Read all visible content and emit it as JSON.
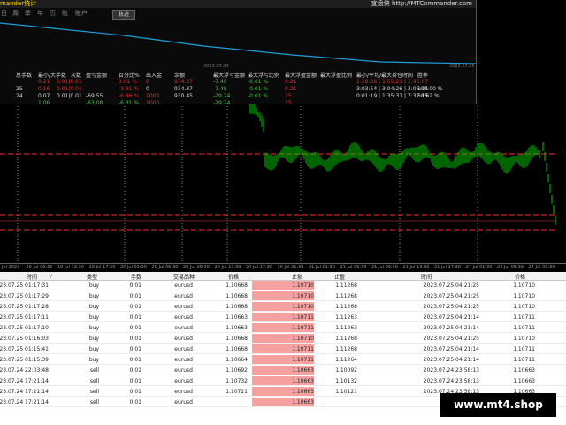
{
  "window": {
    "title": "mander统计",
    "brand": "宜盘侠 http://MTCommander.com"
  },
  "menu": [
    "日",
    "周",
    "季",
    "年",
    "历",
    "账",
    "账户"
  ],
  "track_button": "轨迹",
  "graph_dates": {
    "left": "2023.07.24",
    "right": "2023.07.25"
  },
  "stats": {
    "headers": [
      "总手数",
      "最小/大手数",
      "次数",
      "盈亏金额",
      "百分比%",
      "出入金",
      "余额",
      "最大浮亏金额",
      "最大浮亏比例",
      "最大浮盈金额",
      "最大浮盈比例",
      "最小/平均/最大持仓时间",
      "胜率"
    ],
    "rows": [
      {
        "cells": [
          "",
          "0.21",
          "0.01|0.01",
          "",
          "3.01 %",
          "0",
          "934.37",
          "-7.49",
          "-0.01 %",
          "0.21",
          "",
          "1:28:38 | 1:55:21 | 5:46:07",
          ""
        ],
        "label": ""
      },
      {
        "cells": [
          "25",
          "0.16",
          "0.01|0.01",
          "87",
          "-3.91 %",
          "0",
          "934.37",
          "-7.48",
          "-0.01 %",
          "0.21",
          "",
          "3:03:54 | 3:04:26 | 3:05:35",
          "100.00 %"
        ],
        "label": ""
      },
      {
        "cells": [
          "24",
          "0.07",
          "0.01|0.01",
          "07",
          "-6.96 %",
          "1000",
          "930.45",
          "-29.24",
          "-0.01 %",
          "15",
          "",
          "0:01:19 | 1:35:37 | 7:37:15",
          "58.62 %"
        ],
        "label": ""
      },
      {
        "cells": [
          "",
          "1.06",
          "",
          "",
          "-6.31 %",
          "1000",
          "",
          "-29.24",
          "",
          "15",
          "",
          "",
          ""
        ],
        "label": ""
      }
    ],
    "row_money": [
      "",
      "",
      "-69.55",
      "-63.08"
    ]
  },
  "time_axis": [
    "20 Jul 2023",
    "20 Jul 09:30",
    "19 Jul 13:30",
    "19 Jul 17:30",
    "20 Jul 01:30",
    "20 Jul 05:30",
    "20 Jul 09:30",
    "20 Jul 13:30",
    "20 Jul 17:30",
    "20 Jul 21:30",
    "21 Jul 01:30",
    "21 Jul 05:30",
    "21 Jul 09:30",
    "21 Jul 13:30",
    "21 Jul 17:30",
    "24 Jul 01:30",
    "24 Jul 05:30",
    "24 Jul 09:30"
  ],
  "table": {
    "headers": [
      "时间",
      "类型",
      "手数",
      "交易品种",
      "价格",
      "止损",
      "止盈",
      "时间",
      "价格"
    ],
    "sort_icon": "▽",
    "rows": [
      [
        "2023.07.25 01:17:31",
        "buy",
        "0.01",
        "eurusd",
        "1.10668",
        "1.10710",
        "1.11268",
        "2023.07.25 04:21:25",
        "1.10710"
      ],
      [
        "2023.07.25 01:17:29",
        "buy",
        "0.01",
        "eurusd",
        "1.10668",
        "1.10710",
        "1.11268",
        "2023.07.25 04:21:25",
        "1.10710"
      ],
      [
        "2023.07.25 01:17:28",
        "buy",
        "0.01",
        "eurusd",
        "1.10668",
        "1.10710",
        "1.11268",
        "2023.07.25 04:21:25",
        "1.10710"
      ],
      [
        "2023.07.25 01:17:11",
        "buy",
        "0.01",
        "eurusd",
        "1.10663",
        "1.10711",
        "1.11263",
        "2023.07.25 04:21:14",
        "1.10711"
      ],
      [
        "2023.07.25 01:17:10",
        "buy",
        "0.01",
        "eurusd",
        "1.10663",
        "1.10711",
        "1.11263",
        "2023.07.25 04:21:14",
        "1.10711"
      ],
      [
        "2023.07.25 01:16:03",
        "buy",
        "0.01",
        "eurusd",
        "1.10668",
        "1.10710",
        "1.11268",
        "2023.07.25 04:21:25",
        "1.10710"
      ],
      [
        "2023.07.25 01:15:41",
        "buy",
        "0.01",
        "eurusd",
        "1.10668",
        "1.10711",
        "1.11268",
        "2023.07.25 04:21:14",
        "1.10711"
      ],
      [
        "2023.07.25 01:15:39",
        "buy",
        "0.01",
        "eurusd",
        "1.10664",
        "1.10711",
        "1.11264",
        "2023.07.25 04:21:14",
        "1.10711"
      ],
      [
        "2023.07.24 22:03:48",
        "sell",
        "0.01",
        "eurusd",
        "1.10692",
        "1.10663",
        "1.10092",
        "2023.07.24 23:58:13",
        "1.10663"
      ],
      [
        "2023.07.24 17:21:14",
        "sell",
        "0.01",
        "eurusd",
        "1.10732",
        "1.10663",
        "1.10132",
        "2023.07.24 23:58:13",
        "1.10663"
      ],
      [
        "2023.07.24 17:21:14",
        "sell",
        "0.01",
        "eurusd",
        "1.10721",
        "1.10663",
        "1.10121",
        "2023.07.24 23:58:13",
        "1.10663"
      ],
      [
        "2023.07.24 17:21:14",
        "sell",
        "0.01",
        "eurusd",
        "",
        "1.10663",
        "",
        "",
        ""
      ]
    ]
  },
  "watermark": "www.mt4.shop",
  "colors": {
    "candle": "#00c800",
    "stop_line": "#ff2a2a",
    "equity": "#1ea0dc",
    "stoploss_cell": "#f6a0a0"
  }
}
